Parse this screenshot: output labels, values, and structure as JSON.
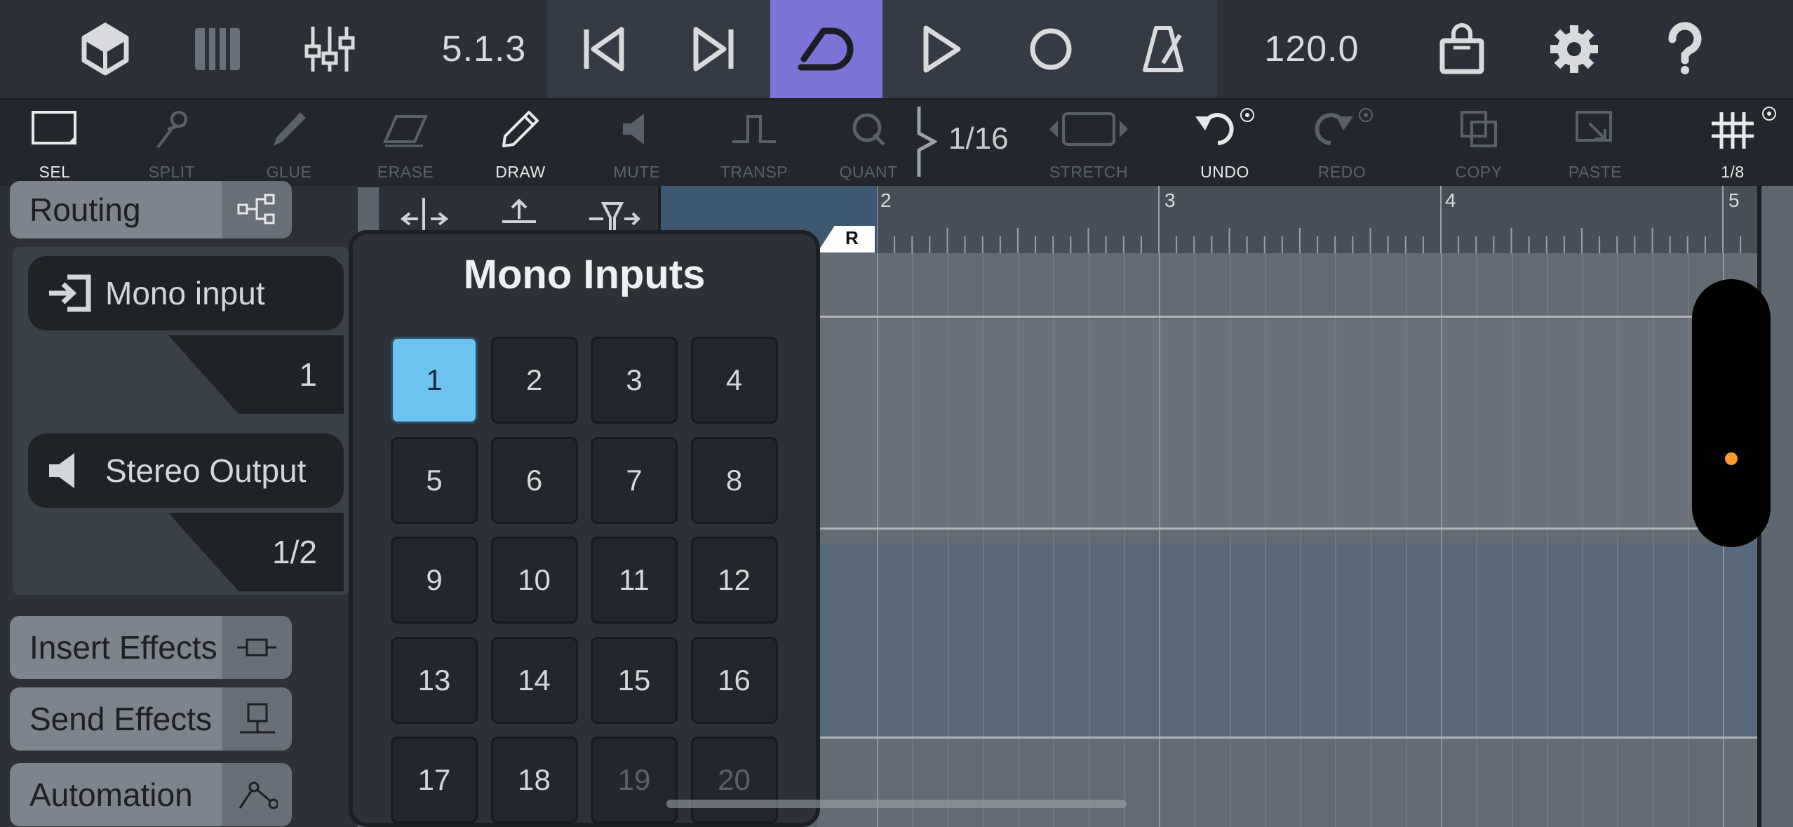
{
  "transport": {
    "position": "5.1.3",
    "tempo": "120.0",
    "cycle_color": "#7b73d6"
  },
  "toolbar": {
    "tools": [
      {
        "label": "SEL",
        "icon": "select-icon",
        "active": true
      },
      {
        "label": "SPLIT",
        "icon": "scissors-icon",
        "active": false
      },
      {
        "label": "GLUE",
        "icon": "glue-icon",
        "active": false
      },
      {
        "label": "ERASE",
        "icon": "eraser-icon",
        "active": false
      },
      {
        "label": "DRAW",
        "icon": "pencil-icon",
        "active": true
      },
      {
        "label": "MUTE",
        "icon": "mute-icon",
        "active": false
      },
      {
        "label": "TRANSP",
        "icon": "transpose-icon",
        "active": false
      },
      {
        "label": "QUANT",
        "icon": "quantize-icon",
        "active": false
      },
      {
        "label": "STRETCH",
        "icon": "stretch-icon",
        "active": false
      },
      {
        "label": "UNDO",
        "icon": "undo-icon",
        "active": true
      },
      {
        "label": "REDO",
        "icon": "redo-icon",
        "active": false
      },
      {
        "label": "COPY",
        "icon": "copy-icon",
        "active": false
      },
      {
        "label": "PASTE",
        "icon": "paste-icon",
        "active": false
      },
      {
        "label": "1/8",
        "icon": "snap-grid-icon",
        "active": true
      }
    ],
    "quantize_value": "1/16"
  },
  "inspector": {
    "routing_label": "Routing",
    "input_label": "Mono input",
    "input_value": "1",
    "output_label": "Stereo Output",
    "output_value": "1/2",
    "insert_label": "Insert Effects",
    "send_label": "Send Effects",
    "automation_label": "Automation"
  },
  "ruler": {
    "bars": [
      "2",
      "3",
      "4",
      "5"
    ],
    "marker": "R"
  },
  "popup": {
    "title": "Mono Inputs",
    "selected": "1",
    "inputs": [
      "1",
      "2",
      "3",
      "4",
      "5",
      "6",
      "7",
      "8",
      "9",
      "10",
      "11",
      "12",
      "13",
      "14",
      "15",
      "16",
      "17",
      "18",
      "19",
      "20"
    ],
    "disabled": [
      "19",
      "20"
    ]
  },
  "colors": {
    "selected_input": "#6cc3f0",
    "scroll_dot": "#ff9a2e"
  }
}
